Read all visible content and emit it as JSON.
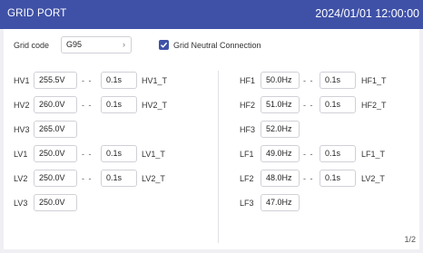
{
  "header": {
    "title": "GRID PORT",
    "datetime": "2024/01/01 12:00:00"
  },
  "grid": {
    "code_label": "Grid code",
    "code_value": "G95",
    "neutral_label": "Grid Neutral Connection",
    "neutral_checked": true
  },
  "dash": "- -",
  "left_rows": [
    {
      "label": "HV1",
      "value": "255.5V",
      "time": "0.1s",
      "tag": "HV1_T"
    },
    {
      "label": "HV2",
      "value": "260.0V",
      "time": "0.1s",
      "tag": "HV2_T"
    },
    {
      "label": "HV3",
      "value": "265.0V"
    },
    {
      "label": "LV1",
      "value": "250.0V",
      "time": "0.1s",
      "tag": "LV1_T"
    },
    {
      "label": "LV2",
      "value": "250.0V",
      "time": "0.1s",
      "tag": "LV2_T"
    },
    {
      "label": "LV3",
      "value": "250.0V"
    }
  ],
  "right_rows": [
    {
      "label": "HF1",
      "value": "50.0Hz",
      "time": "0.1s",
      "tag": "HF1_T"
    },
    {
      "label": "HF2",
      "value": "51.0Hz",
      "time": "0.1s",
      "tag": "HF2_T"
    },
    {
      "label": "HF3",
      "value": "52.0Hz"
    },
    {
      "label": "LF1",
      "value": "49.0Hz",
      "time": "0.1s",
      "tag": "LF1_T"
    },
    {
      "label": "LF2",
      "value": "48.0Hz",
      "time": "0.1s",
      "tag": "LV2_T"
    },
    {
      "label": "LF3",
      "value": "47.0Hz"
    }
  ],
  "page_indicator": "1/2",
  "colors": {
    "header_bg": "#3f51a7",
    "checkbox": "#3f51a7"
  }
}
